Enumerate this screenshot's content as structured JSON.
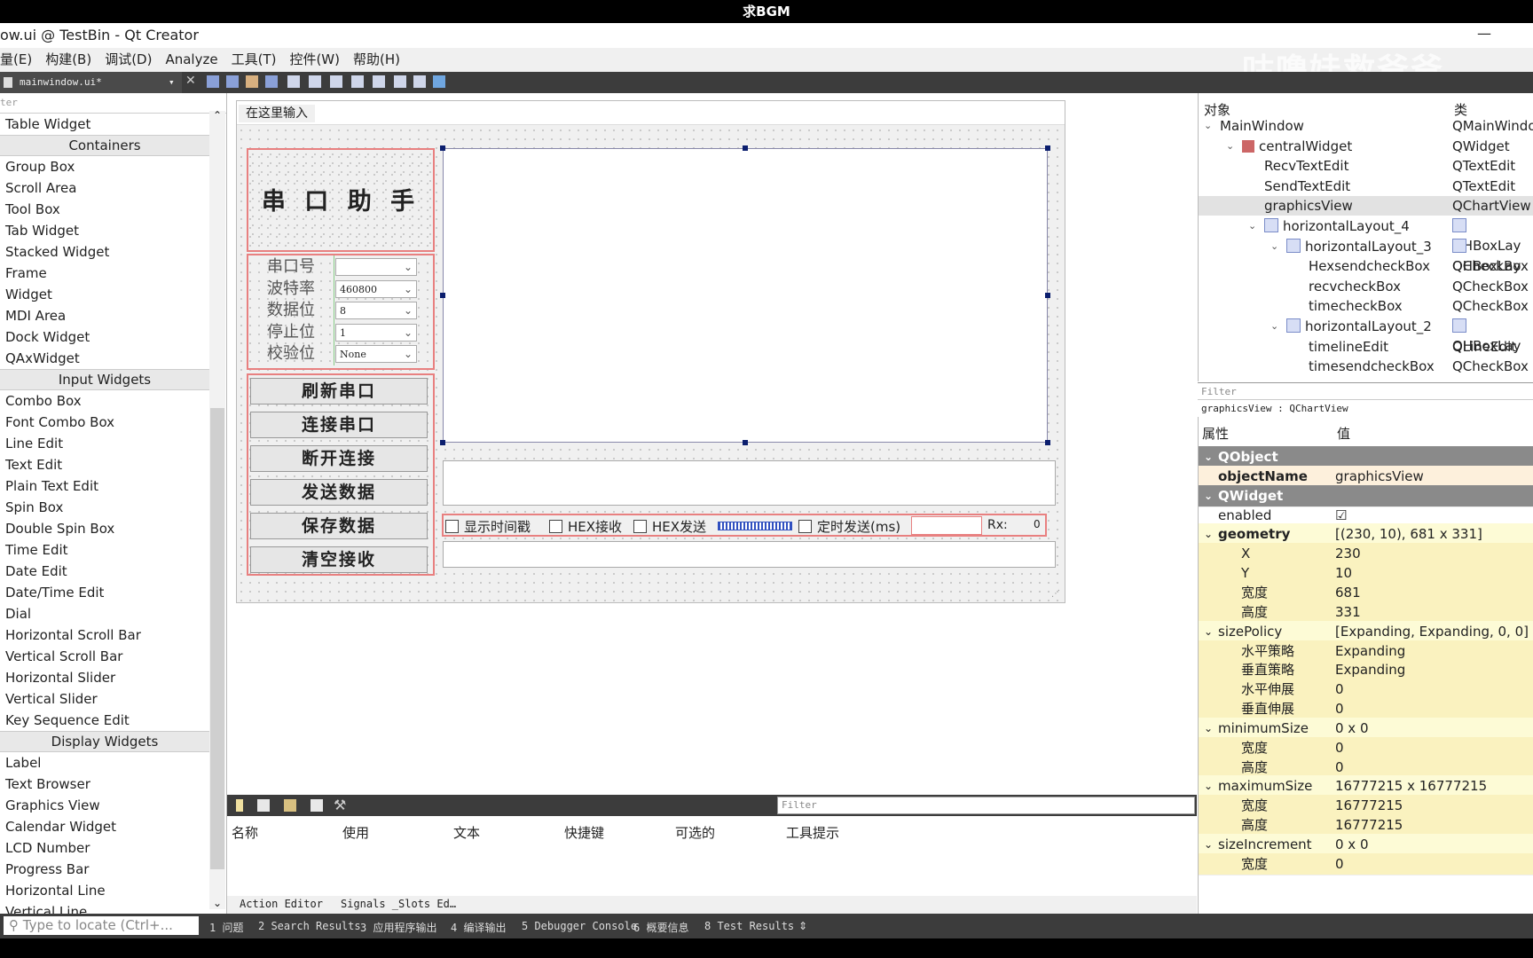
{
  "top_banner": "求BGM",
  "window_title": "ow.ui @ TestBin - Qt Creator",
  "minimize_glyph": "—",
  "watermark": "咕噜娃救爷爷",
  "menubar": [
    "量(E)",
    "构建(B)",
    "调试(D)",
    "Analyze",
    "工具(T)",
    "控件(W)",
    "帮助(H)"
  ],
  "editor_tab": "mainwindow.ui*",
  "widget_box": {
    "filter_placeholder": "ter",
    "sections": [
      {
        "type": "item",
        "label": "Table Widget"
      },
      {
        "type": "cat",
        "label": "Containers"
      },
      {
        "type": "item",
        "label": "Group Box"
      },
      {
        "type": "item",
        "label": "Scroll Area"
      },
      {
        "type": "item",
        "label": "Tool Box"
      },
      {
        "type": "item",
        "label": "Tab Widget"
      },
      {
        "type": "item",
        "label": "Stacked Widget"
      },
      {
        "type": "item",
        "label": "Frame"
      },
      {
        "type": "item",
        "label": "Widget"
      },
      {
        "type": "item",
        "label": "MDI Area"
      },
      {
        "type": "item",
        "label": "Dock Widget"
      },
      {
        "type": "item",
        "label": "QAxWidget"
      },
      {
        "type": "cat",
        "label": "Input Widgets"
      },
      {
        "type": "item",
        "label": "Combo Box"
      },
      {
        "type": "item",
        "label": "Font Combo Box"
      },
      {
        "type": "item",
        "label": "Line Edit"
      },
      {
        "type": "item",
        "label": "Text Edit"
      },
      {
        "type": "item",
        "label": "Plain Text Edit"
      },
      {
        "type": "item",
        "label": "Spin Box"
      },
      {
        "type": "item",
        "label": "Double Spin Box"
      },
      {
        "type": "item",
        "label": "Time Edit"
      },
      {
        "type": "item",
        "label": "Date Edit"
      },
      {
        "type": "item",
        "label": "Date/Time Edit"
      },
      {
        "type": "item",
        "label": "Dial"
      },
      {
        "type": "item",
        "label": "Horizontal Scroll Bar"
      },
      {
        "type": "item",
        "label": "Vertical Scroll Bar"
      },
      {
        "type": "item",
        "label": "Horizontal Slider"
      },
      {
        "type": "item",
        "label": "Vertical Slider"
      },
      {
        "type": "item",
        "label": "Key Sequence Edit"
      },
      {
        "type": "cat",
        "label": "Display Widgets"
      },
      {
        "type": "item",
        "label": "Label"
      },
      {
        "type": "item",
        "label": "Text Browser"
      },
      {
        "type": "item",
        "label": "Graphics View"
      },
      {
        "type": "item",
        "label": "Calendar Widget"
      },
      {
        "type": "item",
        "label": "LCD Number"
      },
      {
        "type": "item",
        "label": "Progress Bar"
      },
      {
        "type": "item",
        "label": "Horizontal Line"
      },
      {
        "type": "item",
        "label": "Vertical Line"
      }
    ]
  },
  "form": {
    "menu_placeholder": "在这里输入",
    "title_label": "串 口 助 手",
    "fields": [
      {
        "label": "串口号",
        "value": ""
      },
      {
        "label": "波特率",
        "value": "460800"
      },
      {
        "label": "数据位",
        "value": "8"
      },
      {
        "label": "停止位",
        "value": "1"
      },
      {
        "label": "校验位",
        "value": "None"
      }
    ],
    "buttons": [
      "刷新串口",
      "连接串口",
      "断开连接",
      "发送数据",
      "保存数据",
      "清空接收"
    ],
    "checks": {
      "timestamp": "显示时间戳",
      "hex_recv": "HEX接收",
      "hex_send": "HEX发送",
      "timed_send": "定时发送(ms)"
    },
    "rx_label": "Rx:",
    "rx_value": "0"
  },
  "action_editor": {
    "filter_placeholder": "Filter",
    "columns": [
      "名称",
      "使用",
      "文本",
      "快捷键",
      "可选的",
      "工具提示"
    ],
    "tabs": [
      "Action Editor",
      "Signals _Slots Ed…"
    ]
  },
  "status_bar": {
    "locate_placeholder": "Type to locate (Ctrl+...",
    "items": [
      "1 问题",
      "2 Search Results",
      "3 应用程序输出",
      "4 编译输出",
      "5 Debugger Console",
      "6 概要信息",
      "8 Test Results"
    ],
    "arrows": "⇕"
  },
  "object_inspector": {
    "col_object": "对象",
    "col_class": "类",
    "rows": [
      {
        "name": "MainWindow",
        "cls": "QMainWindo",
        "indent": 0,
        "arrow": "v",
        "icon": ""
      },
      {
        "name": "centralWidget",
        "cls": "QWidget",
        "indent": 1,
        "arrow": "v",
        "icon": "w"
      },
      {
        "name": "RecvTextEdit",
        "cls": "QTextEdit",
        "indent": 2,
        "arrow": "",
        "icon": ""
      },
      {
        "name": "SendTextEdit",
        "cls": "QTextEdit",
        "indent": 2,
        "arrow": "",
        "icon": ""
      },
      {
        "name": "graphicsView",
        "cls": "QChartView",
        "indent": 2,
        "arrow": "",
        "icon": "",
        "sel": true
      },
      {
        "name": "horizontalLayout_4",
        "cls": "QHBoxLay",
        "indent": 2,
        "arrow": "v",
        "icon": "l"
      },
      {
        "name": "horizontalLayout_3",
        "cls": "QHBoxLay",
        "indent": 3,
        "arrow": "v",
        "icon": "l"
      },
      {
        "name": "HexsendcheckBox",
        "cls": "QCheckBox",
        "indent": 4,
        "arrow": "",
        "icon": ""
      },
      {
        "name": "recvcheckBox",
        "cls": "QCheckBox",
        "indent": 4,
        "arrow": "",
        "icon": ""
      },
      {
        "name": "timecheckBox",
        "cls": "QCheckBox",
        "indent": 4,
        "arrow": "",
        "icon": ""
      },
      {
        "name": "horizontalLayout_2",
        "cls": "QHBoxLay",
        "indent": 3,
        "arrow": "v",
        "icon": "l"
      },
      {
        "name": "timelineEdit",
        "cls": "QLineEdit",
        "indent": 4,
        "arrow": "",
        "icon": ""
      },
      {
        "name": "timesendcheckBox",
        "cls": "QCheckBox",
        "indent": 4,
        "arrow": "",
        "icon": ""
      }
    ]
  },
  "property_editor": {
    "filter_placeholder": "Filter",
    "class_line": "graphicsView : QChartView",
    "col_prop": "属性",
    "col_val": "值",
    "rows": [
      {
        "k": "sec",
        "n": "QObject",
        "v": ""
      },
      {
        "k": "obj",
        "n": "objectName",
        "v": "graphicsView",
        "b": true
      },
      {
        "k": "sec",
        "n": "QWidget",
        "v": ""
      },
      {
        "k": "plain",
        "n": "enabled",
        "v": "☑"
      },
      {
        "k": "yel",
        "n": "geometry",
        "v": "[(230, 10), 681 x 331]",
        "b": true,
        "arrow": true
      },
      {
        "k": "yel2",
        "n": "X",
        "v": "230",
        "sub": true
      },
      {
        "k": "yel2",
        "n": "Y",
        "v": "10",
        "sub": true
      },
      {
        "k": "yel2",
        "n": "宽度",
        "v": "681",
        "sub": true
      },
      {
        "k": "yel2",
        "n": "高度",
        "v": "331",
        "sub": true
      },
      {
        "k": "yel",
        "n": "sizePolicy",
        "v": "[Expanding, Expanding, 0, 0]",
        "arrow": true
      },
      {
        "k": "yel2",
        "n": "水平策略",
        "v": "Expanding",
        "sub": true
      },
      {
        "k": "yel2",
        "n": "垂直策略",
        "v": "Expanding",
        "sub": true
      },
      {
        "k": "yel2",
        "n": "水平伸展",
        "v": "0",
        "sub": true
      },
      {
        "k": "yel2",
        "n": "垂直伸展",
        "v": "0",
        "sub": true
      },
      {
        "k": "yel",
        "n": "minimumSize",
        "v": "0 x 0",
        "arrow": true
      },
      {
        "k": "yel2",
        "n": "宽度",
        "v": "0",
        "sub": true
      },
      {
        "k": "yel2",
        "n": "高度",
        "v": "0",
        "sub": true
      },
      {
        "k": "yel",
        "n": "maximumSize",
        "v": "16777215 x 16777215",
        "arrow": true
      },
      {
        "k": "yel2",
        "n": "宽度",
        "v": "16777215",
        "sub": true
      },
      {
        "k": "yel2",
        "n": "高度",
        "v": "16777215",
        "sub": true
      },
      {
        "k": "yel",
        "n": "sizeIncrement",
        "v": "0 x 0",
        "arrow": true
      },
      {
        "k": "yel2",
        "n": "宽度",
        "v": "0",
        "sub": true
      }
    ]
  }
}
